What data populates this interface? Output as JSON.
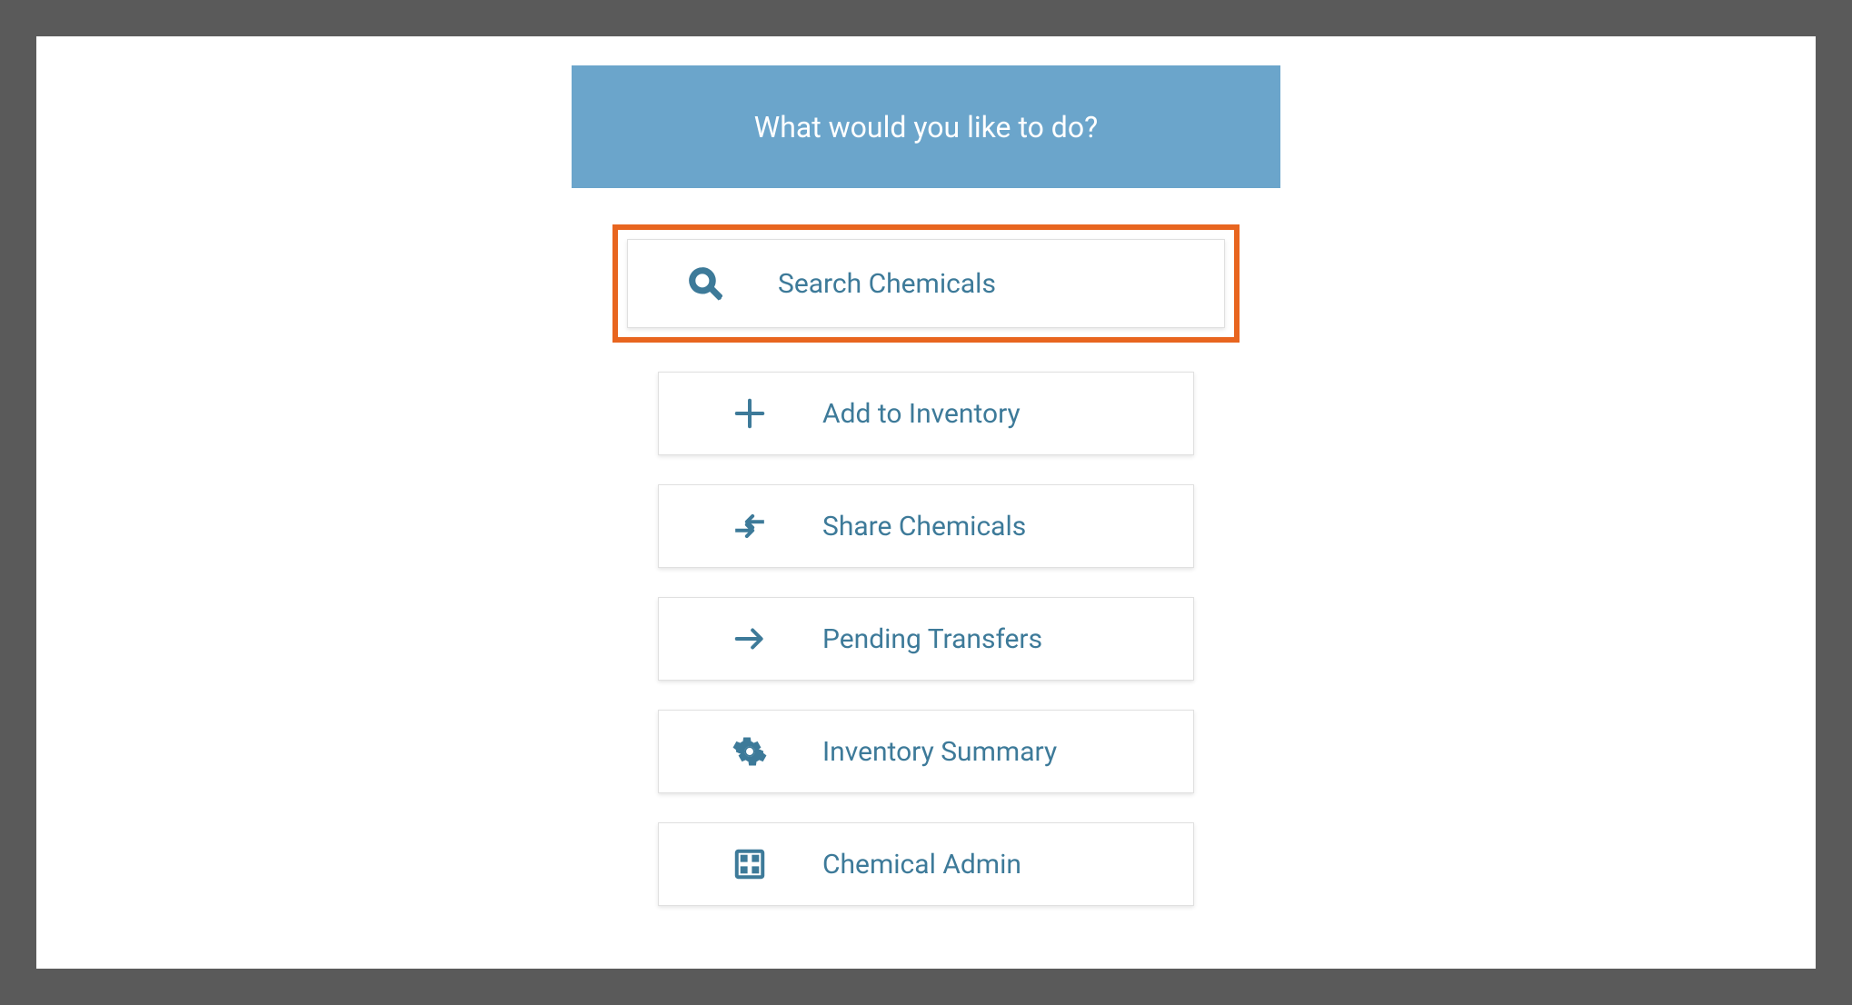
{
  "header": {
    "title": "What would you like to do?"
  },
  "menu": {
    "items": [
      {
        "label": "Search Chemicals",
        "icon": "search-icon",
        "highlighted": true
      },
      {
        "label": "Add to Inventory",
        "icon": "plus-icon",
        "highlighted": false
      },
      {
        "label": "Share Chemicals",
        "icon": "transfer-icon",
        "highlighted": false
      },
      {
        "label": "Pending Transfers",
        "icon": "arrow-right-icon",
        "highlighted": false
      },
      {
        "label": "Inventory Summary",
        "icon": "gear-icon",
        "highlighted": false
      },
      {
        "label": "Chemical Admin",
        "icon": "grid-icon",
        "highlighted": false
      }
    ]
  },
  "colors": {
    "accent": "#3d7a99",
    "banner": "#6ba5cb",
    "highlight_border": "#e8651f"
  }
}
